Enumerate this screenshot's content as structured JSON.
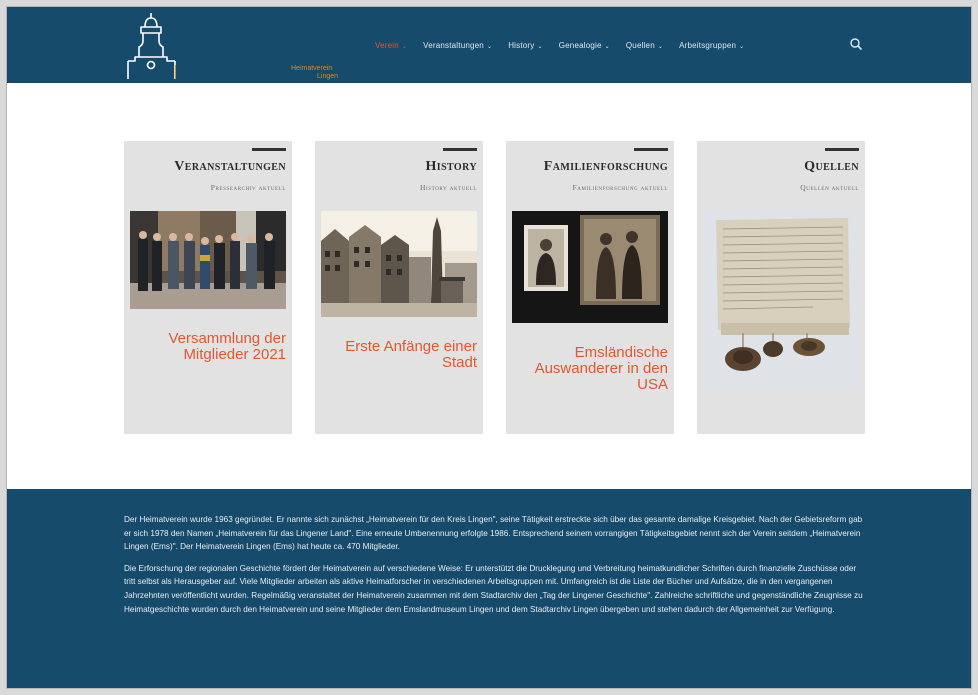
{
  "header": {
    "logo_text_line1": "Heimatverein",
    "logo_text_line2": "Lingen",
    "nav": [
      {
        "label": "Verein",
        "active": true
      },
      {
        "label": "Veranstaltungen",
        "active": false
      },
      {
        "label": "History",
        "active": false
      },
      {
        "label": "Genealogie",
        "active": false
      },
      {
        "label": "Quellen",
        "active": false
      },
      {
        "label": "Arbeitsgruppen",
        "active": false
      }
    ],
    "caret": "⌄"
  },
  "cards": [
    {
      "title": "Veranstaltungen",
      "subtitle": "Pressearchiv aktuell",
      "link": "Versammlung der Mitglieder 2021",
      "image": "group-photo"
    },
    {
      "title": "History",
      "subtitle": "History aktuell",
      "link": "Erste Anfänge einer Stadt",
      "image": "old-town-photo"
    },
    {
      "title": "Familienforschung",
      "subtitle": "Familienforschung aktuell",
      "link": "Emsländische Auswanderer in den USA",
      "image": "old-portrait-photos"
    },
    {
      "title": "Quellen",
      "subtitle": "Quellen aktuell",
      "link": "",
      "image": "historic-document-with-seals"
    }
  ],
  "footer": {
    "paragraph1": "Der Heimatverein wurde 1963 gegründet. Er nannte sich zunächst „Heimatverein für den Kreis Lingen\", seine Tätigkeit erstreckte sich über das gesamte damalige Kreisgebiet. Nach der Gebietsreform gab er sich 1978 den Namen „Heimatverein für das Lingener Land\". Eine erneute Umbenennung erfolgte 1986. Entsprechend seinem vorrangigen Tätigkeitsgebiet nennt sich der Verein seitdem „Heimatverein Lingen (Ems)\". Der Heimatverein Lingen (Ems) hat heute ca. 470 Mitglieder.",
    "paragraph2": "Die Erforschung der regionalen Geschichte fördert der Heimatverein auf verschiedene Weise: Er unterstützt die Drucklegung und Verbreitung heimatkundlicher Schriften durch finanzielle Zuschüsse oder tritt selbst als Herausgeber auf. Viele Mitglieder arbeiten als aktive Heimatforscher in verschiedenen Arbeitsgruppen mit. Umfangreich ist die Liste der Bücher und Aufsätze, die in den vergangenen Jahrzehnten veröffentlicht wurden. Regelmäßig veranstaltet der Heimatverein zusammen mit dem Stadtarchiv den „Tag der Lingener Geschichte\". Zahlreiche schriftliche und gegenständliche Zeugnisse zu Heimatgeschichte wurden durch den Heimatverein und seine Mitglieder dem Emslandmuseum Lingen und dem Stadtarchiv Lingen übergeben und stehen dadurch der Allgemeinheit zur Verfügung."
  },
  "colors": {
    "header_bg": "#164b6b",
    "accent": "#e4562f",
    "card_bg": "#e2e2e2",
    "logo_accent": "#e08a1c"
  },
  "icons": [
    "church-tower-logo-icon",
    "search-icon",
    "chevron-down-icon"
  ]
}
